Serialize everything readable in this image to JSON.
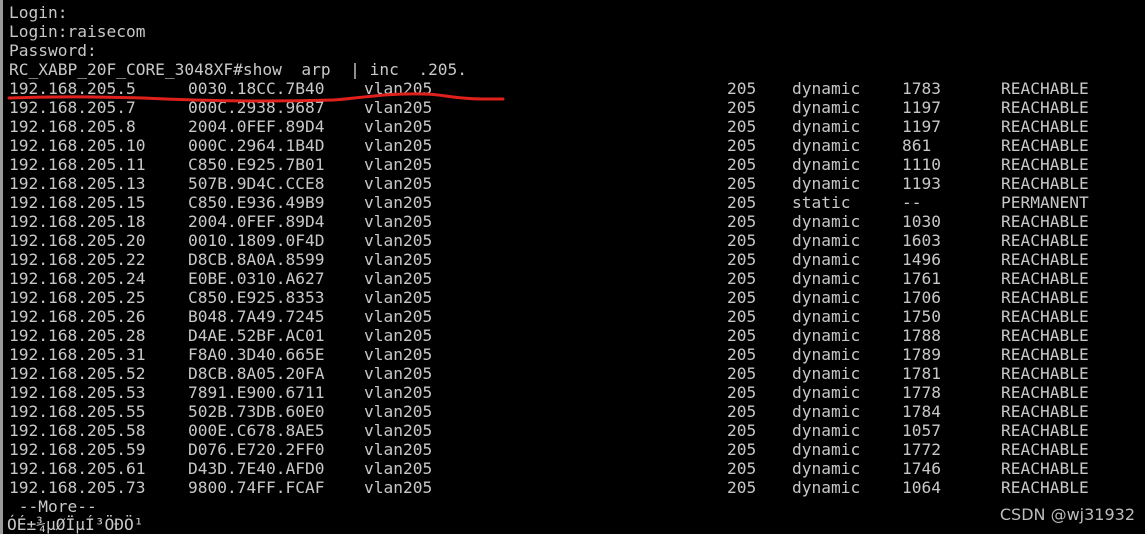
{
  "terminal": {
    "lines": {
      "login1": "Login:",
      "login2": "Login:raisecom",
      "password": "Password:",
      "command": "RC_XABP_20F_CORE_3048XF#show  arp  | inc  .205."
    },
    "arp_entries": [
      {
        "ip": "192.168.205.5",
        "mac": "0030.18CC.7B40",
        "interface": "vlan205",
        "vlan": "205",
        "type": "dynamic",
        "age": "1783",
        "state": "REACHABLE",
        "highlighted": true
      },
      {
        "ip": "192.168.205.7",
        "mac": "000C.2938.9687",
        "interface": "vlan205",
        "vlan": "205",
        "type": "dynamic",
        "age": "1197",
        "state": "REACHABLE"
      },
      {
        "ip": "192.168.205.8",
        "mac": "2004.0FEF.89D4",
        "interface": "vlan205",
        "vlan": "205",
        "type": "dynamic",
        "age": "1197",
        "state": "REACHABLE"
      },
      {
        "ip": "192.168.205.10",
        "mac": "000C.2964.1B4D",
        "interface": "vlan205",
        "vlan": "205",
        "type": "dynamic",
        "age": "861",
        "state": "REACHABLE"
      },
      {
        "ip": "192.168.205.11",
        "mac": "C850.E925.7B01",
        "interface": "vlan205",
        "vlan": "205",
        "type": "dynamic",
        "age": "1110",
        "state": "REACHABLE"
      },
      {
        "ip": "192.168.205.13",
        "mac": "507B.9D4C.CCE8",
        "interface": "vlan205",
        "vlan": "205",
        "type": "dynamic",
        "age": "1193",
        "state": "REACHABLE"
      },
      {
        "ip": "192.168.205.15",
        "mac": "C850.E936.49B9",
        "interface": "vlan205",
        "vlan": "205",
        "type": "static",
        "age": "--",
        "state": "PERMANENT"
      },
      {
        "ip": "192.168.205.18",
        "mac": "2004.0FEF.89D4",
        "interface": "vlan205",
        "vlan": "205",
        "type": "dynamic",
        "age": "1030",
        "state": "REACHABLE"
      },
      {
        "ip": "192.168.205.20",
        "mac": "0010.1809.0F4D",
        "interface": "vlan205",
        "vlan": "205",
        "type": "dynamic",
        "age": "1603",
        "state": "REACHABLE"
      },
      {
        "ip": "192.168.205.22",
        "mac": "D8CB.8A0A.8599",
        "interface": "vlan205",
        "vlan": "205",
        "type": "dynamic",
        "age": "1496",
        "state": "REACHABLE"
      },
      {
        "ip": "192.168.205.24",
        "mac": "E0BE.0310.A627",
        "interface": "vlan205",
        "vlan": "205",
        "type": "dynamic",
        "age": "1761",
        "state": "REACHABLE"
      },
      {
        "ip": "192.168.205.25",
        "mac": "C850.E925.8353",
        "interface": "vlan205",
        "vlan": "205",
        "type": "dynamic",
        "age": "1706",
        "state": "REACHABLE"
      },
      {
        "ip": "192.168.205.26",
        "mac": "B048.7A49.7245",
        "interface": "vlan205",
        "vlan": "205",
        "type": "dynamic",
        "age": "1750",
        "state": "REACHABLE"
      },
      {
        "ip": "192.168.205.28",
        "mac": "D4AE.52BF.AC01",
        "interface": "vlan205",
        "vlan": "205",
        "type": "dynamic",
        "age": "1788",
        "state": "REACHABLE"
      },
      {
        "ip": "192.168.205.31",
        "mac": "F8A0.3D40.665E",
        "interface": "vlan205",
        "vlan": "205",
        "type": "dynamic",
        "age": "1789",
        "state": "REACHABLE"
      },
      {
        "ip": "192.168.205.52",
        "mac": "D8CB.8A05.20FA",
        "interface": "vlan205",
        "vlan": "205",
        "type": "dynamic",
        "age": "1781",
        "state": "REACHABLE"
      },
      {
        "ip": "192.168.205.53",
        "mac": "7891.E900.6711",
        "interface": "vlan205",
        "vlan": "205",
        "type": "dynamic",
        "age": "1778",
        "state": "REACHABLE"
      },
      {
        "ip": "192.168.205.55",
        "mac": "502B.73DB.60E0",
        "interface": "vlan205",
        "vlan": "205",
        "type": "dynamic",
        "age": "1784",
        "state": "REACHABLE"
      },
      {
        "ip": "192.168.205.58",
        "mac": "000E.C678.8AE5",
        "interface": "vlan205",
        "vlan": "205",
        "type": "dynamic",
        "age": "1057",
        "state": "REACHABLE"
      },
      {
        "ip": "192.168.205.59",
        "mac": "D076.E720.2FF0",
        "interface": "vlan205",
        "vlan": "205",
        "type": "dynamic",
        "age": "1772",
        "state": "REACHABLE"
      },
      {
        "ip": "192.168.205.61",
        "mac": "D43D.7E40.AFD0",
        "interface": "vlan205",
        "vlan": "205",
        "type": "dynamic",
        "age": "1746",
        "state": "REACHABLE"
      },
      {
        "ip": "192.168.205.73",
        "mac": "9800.74FF.FCAF",
        "interface": "vlan205",
        "vlan": "205",
        "type": "dynamic",
        "age": "1064",
        "state": "REACHABLE"
      }
    ],
    "more_prompt": " --More--",
    "garbled_line": "ÓÉ±¾µØÏµÍ³ÖÐÖ¹",
    "annotation_color": "#e0201c"
  },
  "watermark": "CSDN @wj31932"
}
